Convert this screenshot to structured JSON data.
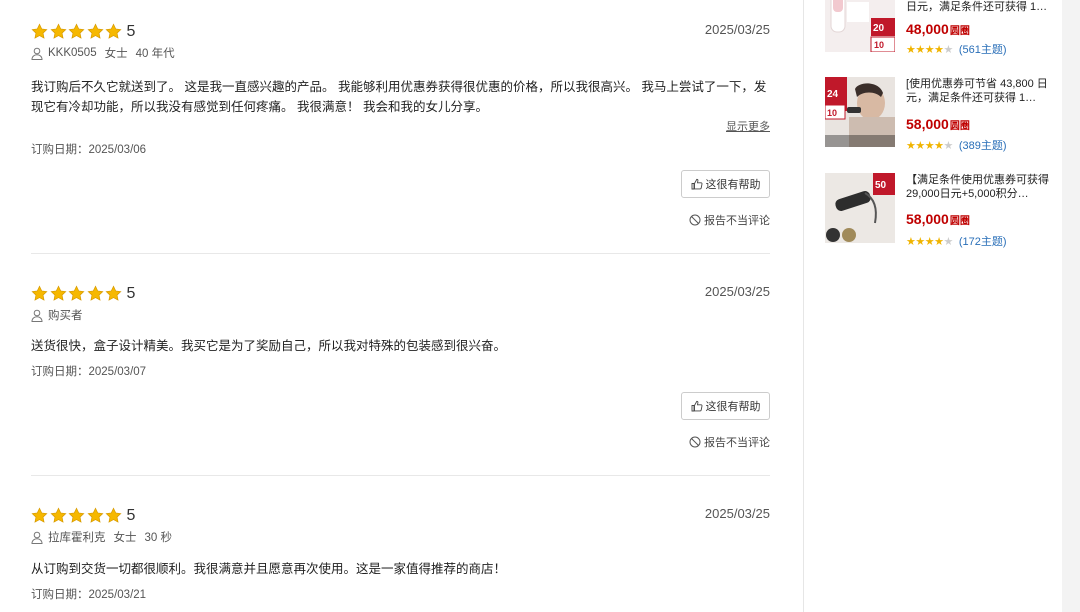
{
  "reviews": [
    {
      "stars": 5,
      "score": "5",
      "date": "2025/03/25",
      "user": "KKK0505",
      "gender": "女士",
      "age": "40 年代",
      "text": "我订购后不久它就送到了。 这是我一直感兴趣的产品。 我能够利用优惠券获得很优惠的价格，所以我很高兴。 我马上尝试了一下，发现它有冷却功能，所以我没有感觉到任何疼痛。 我很满意！ 我会和我的女儿分享。",
      "more": "显示更多",
      "order_date": "订购日期：2025/03/06",
      "helpful": "这很有帮助",
      "report": "报告不当评论"
    },
    {
      "stars": 5,
      "score": "5",
      "date": "2025/03/25",
      "user": "购买者",
      "text": "送货很快，盒子设计精美。我买它是为了奖励自己，所以我对特殊的包装感到很兴奋。",
      "order_date": "订购日期：2025/03/07",
      "helpful": "这很有帮助",
      "report": "报告不当评论"
    },
    {
      "stars": 5,
      "score": "5",
      "date": "2025/03/25",
      "user": "拉库霍利克",
      "gender": "女士",
      "age": "30 秒",
      "text": "从订购到交货一切都很顺利。我很满意并且愿意再次使用。这是一家值得推荐的商店！",
      "order_date": "订购日期：2025/03/21"
    }
  ],
  "products": [
    {
      "title": "日元，满足条件还可获得 1…",
      "price": "48,000",
      "unit": "圆圈",
      "rating_stars": 4,
      "count": "(561主题)",
      "badge_top": "20",
      "badge_bottom": "10"
    },
    {
      "title": "[使用优惠券可节省 43,800 日元，满足条件还可获得 1…",
      "price": "58,000",
      "unit": "圆圈",
      "rating_stars": 4,
      "count": "(389主题)",
      "badge_top": "24",
      "badge_bottom": "10"
    },
    {
      "title": "【满足条件使用优惠券可获得 29,000日元+5,000积分…",
      "price": "58,000",
      "unit": "圆圈",
      "rating_stars": 4,
      "count": "(172主题)",
      "badge_top": "50"
    }
  ]
}
